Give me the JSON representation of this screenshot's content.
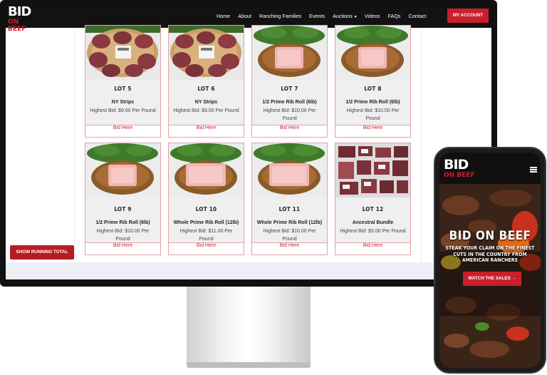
{
  "desktop": {
    "logo": {
      "line1": "BID",
      "line2": "ON BEEF"
    },
    "nav": [
      {
        "label": "Home"
      },
      {
        "label": "About"
      },
      {
        "label": "Ranching Families"
      },
      {
        "label": "Events"
      },
      {
        "label": "Auctions"
      },
      {
        "label": "Videos"
      },
      {
        "label": "FAQs"
      },
      {
        "label": "Contact"
      }
    ],
    "account_label": "MY ACCOUNT",
    "running_total_label": "SHOW RUNNING TOTAL",
    "lots": [
      {
        "lot": "LOT 5",
        "title": "NY Strips",
        "bid": "Highest Bid: $9.00 Per Pound",
        "button": "Bid Here",
        "image": "steaks-image"
      },
      {
        "lot": "LOT 6",
        "title": "NY Strips",
        "bid": "Highest Bid: $9.00 Per Pound",
        "button": "Bid Here",
        "image": "steaks-image"
      },
      {
        "lot": "LOT 7",
        "title": "1/2 Prime Rib Roll (6lb)",
        "bid": "Highest Bid: $10.00 Per Pound",
        "button": "Bid Here",
        "image": "basket-image"
      },
      {
        "lot": "LOT 8",
        "title": "1/2 Prime Rib Roll (6lb)",
        "bid": "Highest Bid: $10.00 Per Pound",
        "button": "Bid Here",
        "image": "basket-image"
      },
      {
        "lot": "LOT 9",
        "title": "1/2 Prime Rib Roll (6lb)",
        "bid": "Highest Bid: $10.00 Per Pound",
        "button": "Bid Here",
        "image": "basket-image"
      },
      {
        "lot": "LOT 10",
        "title": "Whole Prime Rib Roll (12lb)",
        "bid": "Highest Bid: $11.00 Per Pound",
        "button": "Bid Here",
        "image": "basket-image"
      },
      {
        "lot": "LOT 11",
        "title": "Whole Prime Rib Roll (12lb)",
        "bid": "Highest Bid: $10.00 Per Pound",
        "button": "Bid Here",
        "image": "basket-image"
      },
      {
        "lot": "LOT 12",
        "title": "Ancestral Bundle",
        "bid": "Highest Bid: $5.00 Per Pound",
        "button": "Bid Here",
        "image": "bundle-image"
      }
    ]
  },
  "mobile": {
    "logo": {
      "line1": "BID",
      "line2": "ON BEEF"
    },
    "hero_title": "BID ON BEEF",
    "hero_subtitle_accent": "STEAK YOUR CLAIM",
    "hero_subtitle_rest": " ON THE FINEST CUTS IN THE COUNTRY FROM AMERICAN RANCHERS",
    "cta_label": "WATCH THE SALES →"
  },
  "colors": {
    "brand_red": "#c8202a",
    "dark": "#121212",
    "card_bg": "#efefef"
  }
}
